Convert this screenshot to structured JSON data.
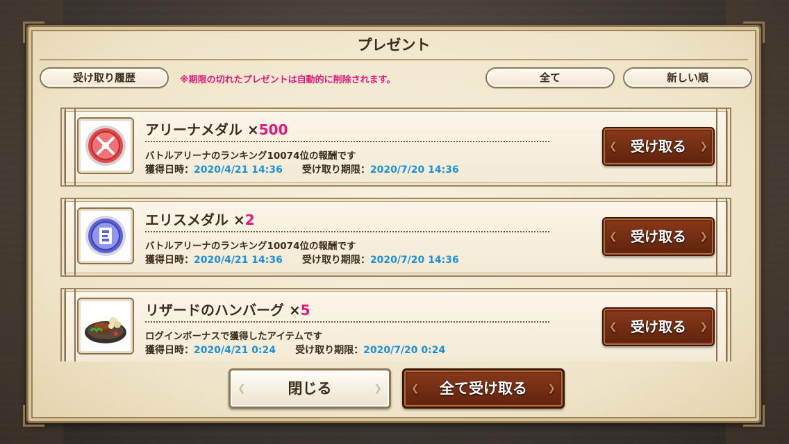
{
  "dialog": {
    "title": "プレゼント",
    "history_button": "受け取り履歴",
    "notice": "※期限の切れたプレゼントは自動的に削除されます。",
    "filter_button": "全て",
    "sort_button": "新しい順"
  },
  "presents": [
    {
      "name": "アリーナメダル ×",
      "quantity": "500",
      "description": "バトルアリーナのランキング10074位の報酬です",
      "obtained_label": "獲得日時：",
      "obtained_value": "2020/4/21 14:36",
      "expiry_label": "受け取り期限：",
      "expiry_value": "2020/7/20 14:36",
      "button": "受け取る",
      "icon": "arena-medal-icon"
    },
    {
      "name": "エリスメダル ×",
      "quantity": "2",
      "description": "バトルアリーナのランキング10074位の報酬です",
      "obtained_label": "獲得日時：",
      "obtained_value": "2020/4/21 14:36",
      "expiry_label": "受け取り期限：",
      "expiry_value": "2020/7/20 14:36",
      "button": "受け取る",
      "icon": "eris-medal-icon"
    },
    {
      "name": "リザードのハンバーグ ×",
      "quantity": "5",
      "description": "ログインボーナスで獲得したアイテムです",
      "obtained_label": "獲得日時：",
      "obtained_value": "2020/4/21 0:24",
      "expiry_label": "受け取り期限：",
      "expiry_value": "2020/7/20 0:24",
      "button": "受け取る",
      "icon": "hamburger-steak-icon"
    }
  ],
  "footer": {
    "close_button": "閉じる",
    "receive_all_button": "全て受け取る"
  },
  "colors": {
    "quantity": "#e2177a",
    "date_value": "#1c8fd8",
    "notice": "#e2177a",
    "receive_button": "#6e2a10"
  }
}
